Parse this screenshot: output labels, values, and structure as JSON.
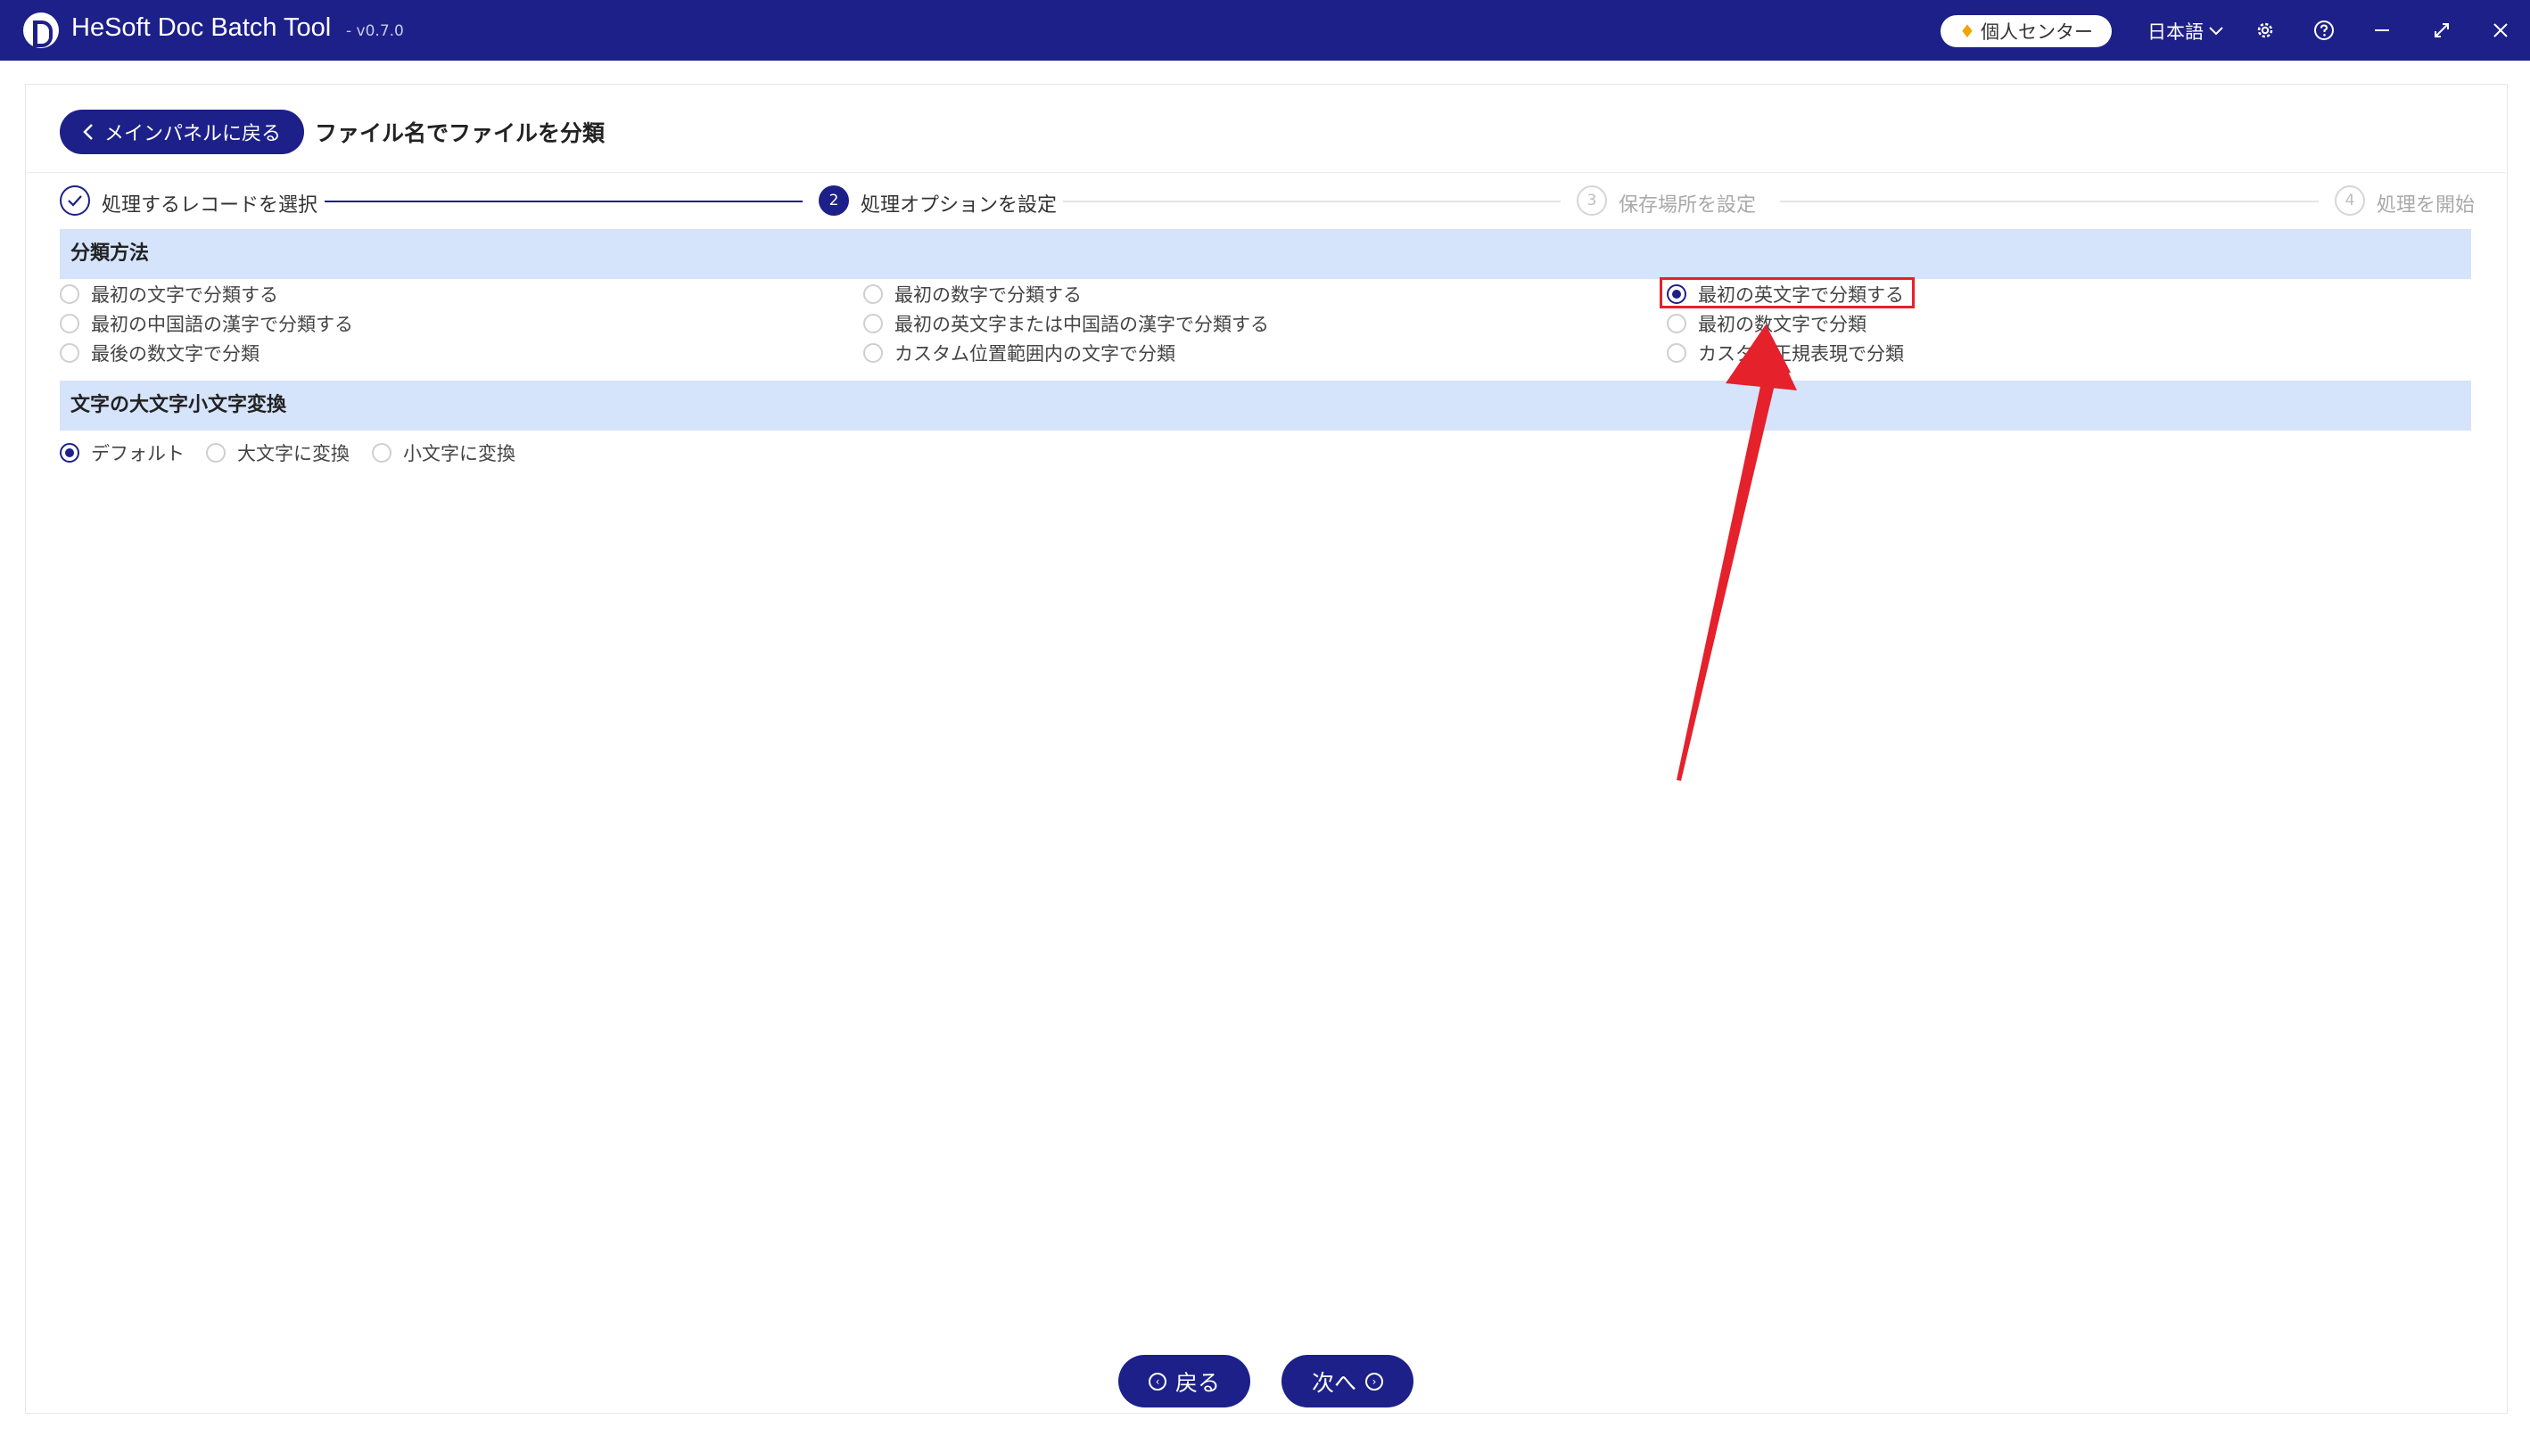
{
  "app": {
    "title": "HeSoft Doc Batch Tool",
    "version": "- v0.7.0",
    "user_center": "個人センター",
    "language": "日本語",
    "accent_color": "#1d2088"
  },
  "header": {
    "back_label": "メインパネルに戻る",
    "page_title": "ファイル名でファイルを分類"
  },
  "steps": [
    {
      "number": "",
      "label": "処理するレコードを選択",
      "state": "done",
      "icon": "check-icon"
    },
    {
      "number": "2",
      "label": "処理オプションを設定",
      "state": "active"
    },
    {
      "number": "3",
      "label": "保存場所を設定",
      "state": "todo"
    },
    {
      "number": "4",
      "label": "処理を開始",
      "state": "todo"
    }
  ],
  "classification": {
    "title": "分類方法",
    "options": [
      {
        "label": "最初の文字で分類する",
        "checked": false
      },
      {
        "label": "最初の数字で分類する",
        "checked": false
      },
      {
        "label": "最初の英文字で分類する",
        "checked": true
      },
      {
        "label": "最初の中国語の漢字で分類する",
        "checked": false
      },
      {
        "label": "最初の英文字または中国語の漢字で分類する",
        "checked": false
      },
      {
        "label": "最初の数文字で分類",
        "checked": false
      },
      {
        "label": "最後の数文字で分類",
        "checked": false
      },
      {
        "label": "カスタム位置範囲内の文字で分類",
        "checked": false
      },
      {
        "label": "カスタム正規表現で分類",
        "checked": false
      }
    ]
  },
  "case_conversion": {
    "title": "文字の大文字小文字変換",
    "options": [
      {
        "label": "デフォルト",
        "checked": true
      },
      {
        "label": "大文字に変換",
        "checked": false
      },
      {
        "label": "小文字に変換",
        "checked": false
      }
    ]
  },
  "footer": {
    "back_label": "戻る",
    "next_label": "次へ"
  },
  "annotation": {
    "highlight_color": "#e5212b"
  }
}
